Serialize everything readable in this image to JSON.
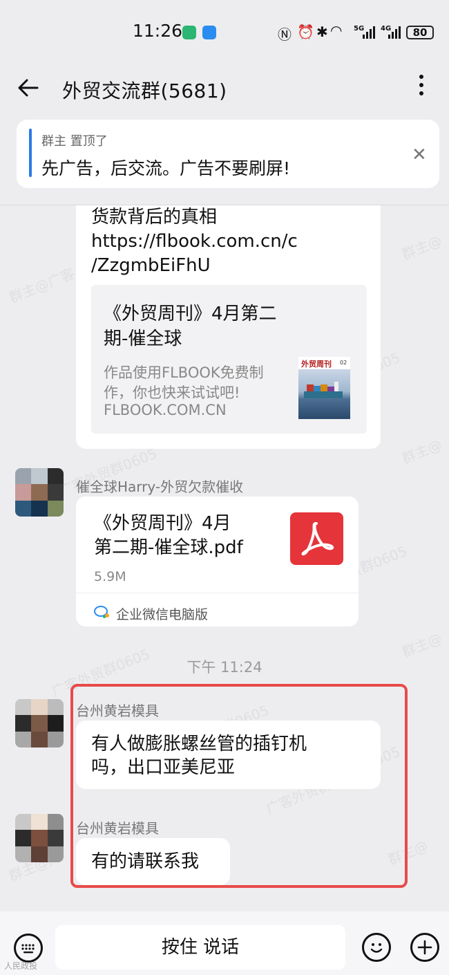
{
  "status_bar": {
    "time": "11:26",
    "battery": "80",
    "net1": "5G",
    "net2": "4G"
  },
  "header": {
    "title": "外贸交流群(5681)"
  },
  "pinned": {
    "meta": "群主 置顶了",
    "text": "先广告，后交流。广告不要刷屏!"
  },
  "messages": {
    "link_message": {
      "text": "货款背后的真相",
      "link_line1": "https://flbook.com.cn/c",
      "link_line2": "/ZzgmbEiFhU",
      "card_title_1": "《外贸周刊》4月第二",
      "card_title_2": "期-催全球",
      "card_desc_1": "作品使用FLBOOK免费制",
      "card_desc_2": "作，你也快来试试吧!",
      "card_domain": "FLBOOK.COM.CN",
      "thumb_title": "外贸周刊",
      "thumb_issue": "02"
    },
    "file_message": {
      "sender": "催全球Harry-外贸欠款催收",
      "file_name_1": "《外贸周刊》4月",
      "file_name_2": "第二期-催全球.pdf",
      "size": "5.9M",
      "source": "企业微信电脑版"
    },
    "timestamp": "下午 11:24",
    "msg1": {
      "sender": "台州黄岩模具",
      "text_1": "有人做膨胀螺丝管的插钉机",
      "text_2": "吗，出口亚美尼亚"
    },
    "msg2": {
      "sender": "台州黄岩模具",
      "text": "有的请联系我"
    }
  },
  "watermarks": {
    "a": "群主@广客",
    "b": "群主@广",
    "c": "广客外贸群0605",
    "d": "贸群0605",
    "e": "群主@"
  },
  "bottom": {
    "voice_label": "按住 说话",
    "corner_watermark": "人民政投"
  },
  "colors": {
    "accent": "#2c7be5",
    "link": "#1e6fd9",
    "highlight": "#e84a4a",
    "pdf": "#e5343a"
  }
}
